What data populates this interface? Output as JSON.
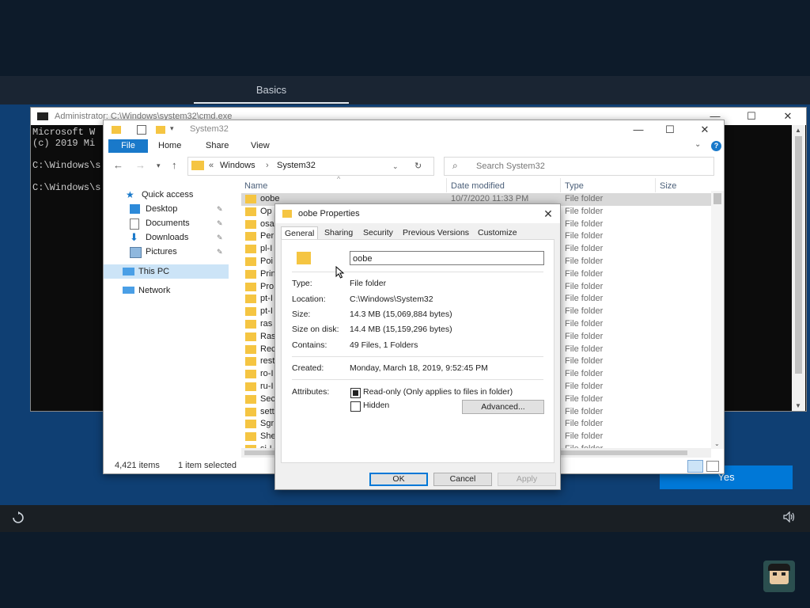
{
  "oobe": {
    "tab_label": "Basics",
    "yes_button": "Yes"
  },
  "cmd": {
    "title": "Administrator: C:\\Windows\\system32\\cmd.exe",
    "lines": [
      "Microsoft W",
      "(c) 2019 Mi",
      "",
      "C:\\Windows\\s",
      "",
      "C:\\Windows\\s"
    ]
  },
  "explorer": {
    "title": "System32",
    "ribbon": {
      "file": "File",
      "home": "Home",
      "share": "Share",
      "view": "View"
    },
    "address": {
      "prefix": "«",
      "crumb1": "Windows",
      "sep": "›",
      "crumb2": "System32"
    },
    "search_placeholder": "Search System32",
    "nav": {
      "quick_access": "Quick access",
      "desktop": "Desktop",
      "documents": "Documents",
      "downloads": "Downloads",
      "pictures": "Pictures",
      "this_pc": "This PC",
      "network": "Network"
    },
    "columns": {
      "name": "Name",
      "date": "Date modified",
      "type": "Type",
      "size": "Size"
    },
    "rows": [
      {
        "name": "oobe",
        "date": "10/7/2020 11:33 PM",
        "type": "File folder"
      },
      {
        "name": "Op",
        "type": "File folder"
      },
      {
        "name": "osa",
        "type": "File folder"
      },
      {
        "name": "Per",
        "type": "File folder"
      },
      {
        "name": "pl-I",
        "type": "File folder"
      },
      {
        "name": "Poi",
        "type": "File folder"
      },
      {
        "name": "Prin",
        "type": "File folder"
      },
      {
        "name": "Pro",
        "type": "File folder"
      },
      {
        "name": "pt-I",
        "type": "File folder"
      },
      {
        "name": "pt-I",
        "type": "File folder"
      },
      {
        "name": "ras",
        "type": "File folder"
      },
      {
        "name": "Ras",
        "type": "File folder"
      },
      {
        "name": "Rec",
        "type": "File folder"
      },
      {
        "name": "rest",
        "type": "File folder"
      },
      {
        "name": "ro-I",
        "type": "File folder"
      },
      {
        "name": "ru-I",
        "type": "File folder"
      },
      {
        "name": "Sec",
        "type": "File folder"
      },
      {
        "name": "sett",
        "type": "File folder"
      },
      {
        "name": "Sgr",
        "type": "File folder"
      },
      {
        "name": "She",
        "type": "File folder"
      },
      {
        "name": "si-I",
        "type": "File folder"
      }
    ],
    "status": {
      "items": "4,421 items",
      "selected": "1 item selected"
    }
  },
  "properties": {
    "title": "oobe Properties",
    "tabs": {
      "general": "General",
      "sharing": "Sharing",
      "security": "Security",
      "previous_versions": "Previous Versions",
      "customize": "Customize"
    },
    "name": "oobe",
    "type_label": "Type:",
    "type_value": "File folder",
    "location_label": "Location:",
    "location_value": "C:\\Windows\\System32",
    "size_label": "Size:",
    "size_value": "14.3 MB (15,069,884 bytes)",
    "size_on_disk_label": "Size on disk:",
    "size_on_disk_value": "14.4 MB (15,159,296 bytes)",
    "contains_label": "Contains:",
    "contains_value": "49 Files, 1 Folders",
    "created_label": "Created:",
    "created_value": "Monday, March 18, 2019, 9:52:45 PM",
    "attributes_label": "Attributes:",
    "readonly_label": "Read-only (Only applies to files in folder)",
    "hidden_label": "Hidden",
    "advanced_button": "Advanced...",
    "ok_button": "OK",
    "cancel_button": "Cancel",
    "apply_button": "Apply"
  }
}
